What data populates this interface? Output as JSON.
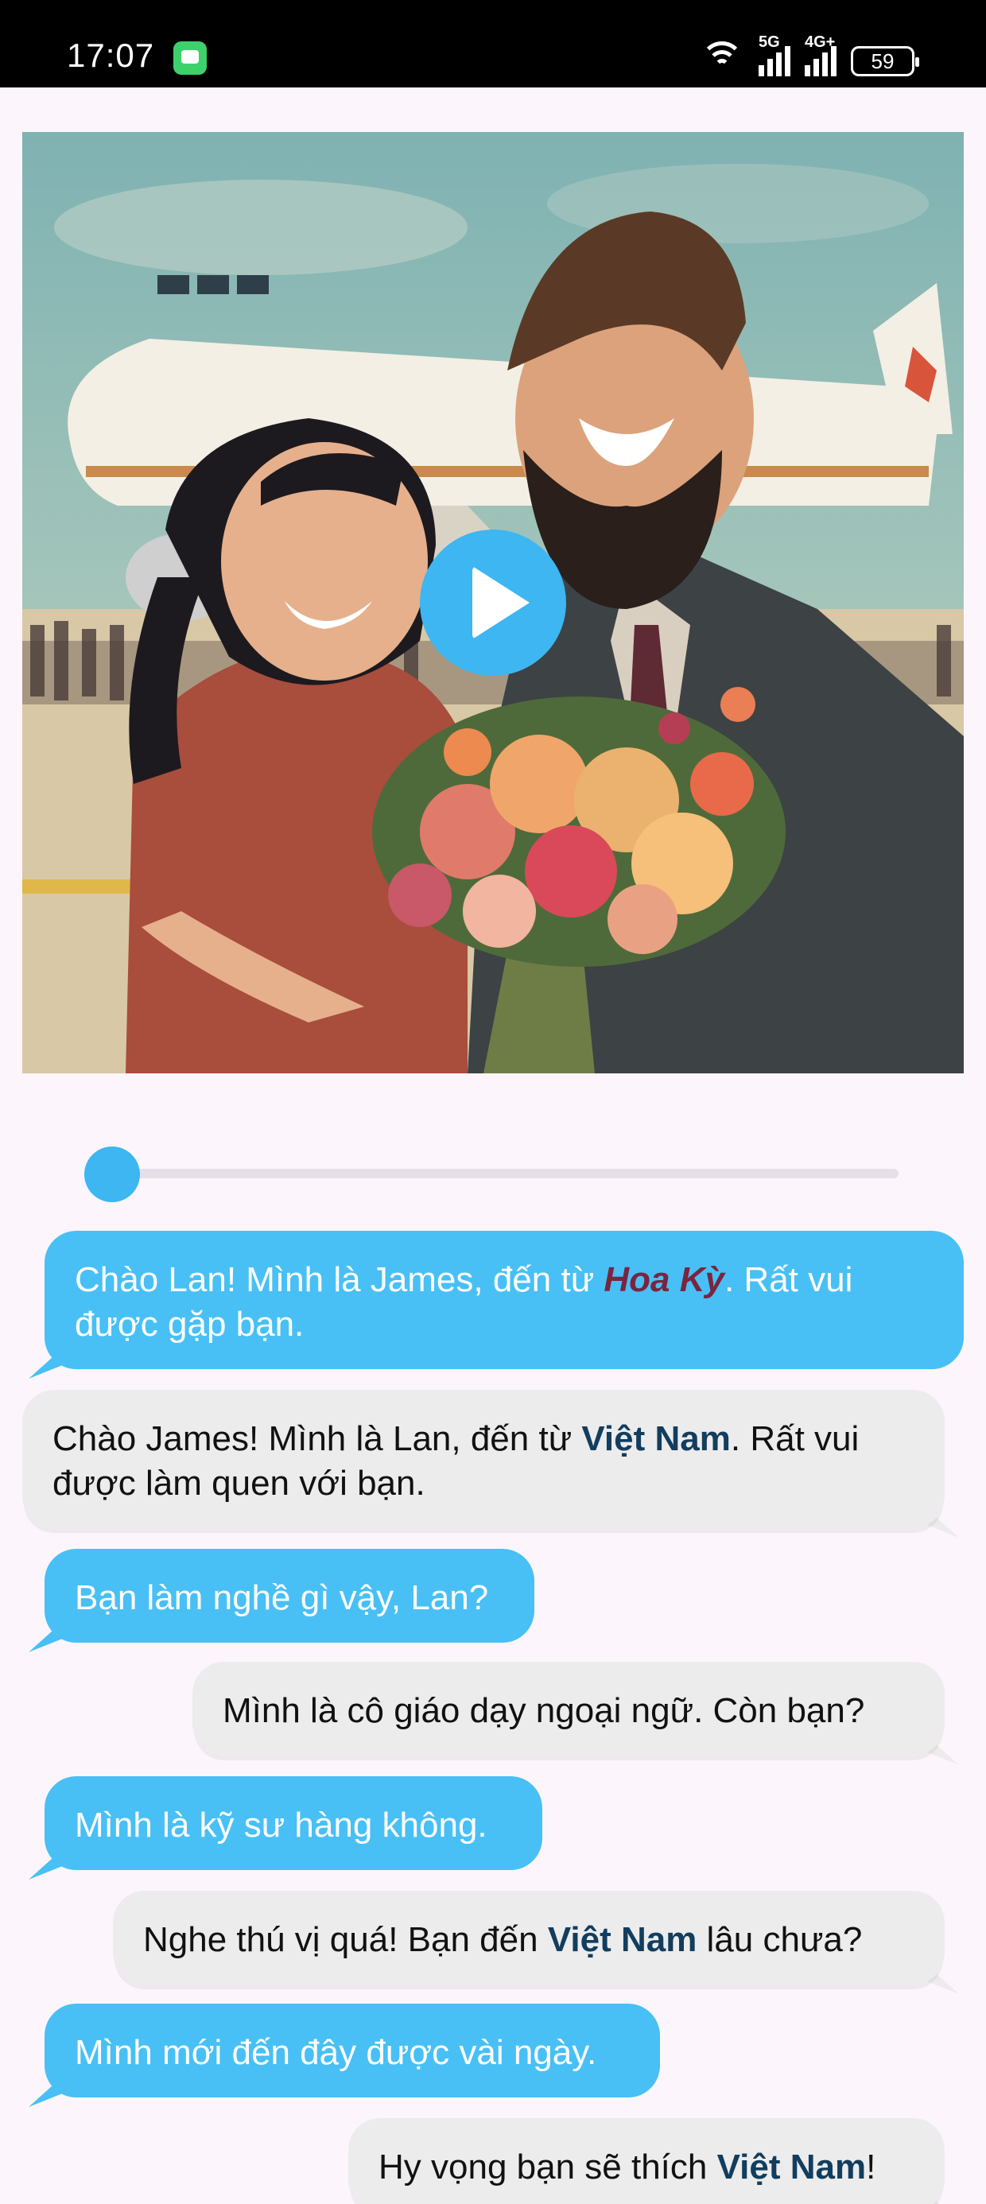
{
  "status_bar": {
    "time": "17:07",
    "signal_1_label": "5G",
    "signal_2_label": "4G+",
    "battery": "59"
  },
  "video": {
    "illustration": "woman-and-bearded-man-with-bouquet-at-airport",
    "play_icon": "play-icon"
  },
  "slider": {
    "progress": 0.0
  },
  "chat": [
    {
      "side": "left",
      "parts": [
        {
          "text": "Chào Lan! Mình là James, đến từ "
        },
        {
          "text": "Hoa Kỳ",
          "style": "hl-us"
        },
        {
          "text": ". Rất vui được gặp bạn."
        }
      ]
    },
    {
      "side": "right",
      "parts": [
        {
          "text": "Chào James! Mình là Lan, đến từ "
        },
        {
          "text": "Việt Nam",
          "style": "hl-vn"
        },
        {
          "text": ". Rất vui được làm quen với bạn."
        }
      ]
    },
    {
      "side": "left",
      "parts": [
        {
          "text": "Bạn làm nghề gì vậy, Lan?"
        }
      ]
    },
    {
      "side": "right",
      "parts": [
        {
          "text": "Mình là cô giáo dạy ngoại ngữ. Còn bạn?"
        }
      ]
    },
    {
      "side": "left",
      "parts": [
        {
          "text": "Mình là kỹ sư hàng không."
        }
      ]
    },
    {
      "side": "right",
      "parts": [
        {
          "text": "Nghe thú vị quá! Bạn đến "
        },
        {
          "text": "Việt Nam",
          "style": "hl-vn"
        },
        {
          "text": " lâu chưa?"
        }
      ]
    },
    {
      "side": "left",
      "parts": [
        {
          "text": "Mình mới đến đây được vài ngày."
        }
      ]
    },
    {
      "side": "right",
      "parts": [
        {
          "text": "Hy vọng bạn sẽ thích "
        },
        {
          "text": "Việt Nam",
          "style": "hl-vn"
        },
        {
          "text": "!"
        }
      ]
    }
  ],
  "colors": {
    "accent": "#48c0f5",
    "bubble_grey": "#ececec",
    "highlight_country_us": "#7a2540",
    "highlight_country_vn": "#123d5e"
  }
}
